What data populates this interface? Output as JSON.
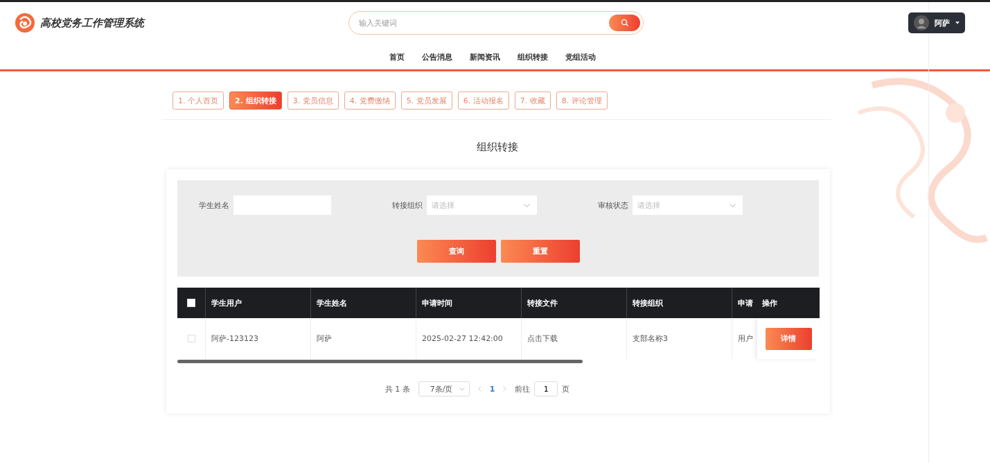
{
  "header": {
    "title": "高校党务工作管理系统",
    "search": {
      "placeholder": "输入关键词"
    },
    "user": {
      "name": "阿萨"
    }
  },
  "nav": [
    "首页",
    "公告消息",
    "新闻资讯",
    "组织转接",
    "党组活动"
  ],
  "tabs": [
    {
      "label": "1. 个人首页",
      "selected": false
    },
    {
      "label": "2. 组织转接",
      "selected": true
    },
    {
      "label": "3. 党员信息",
      "selected": false
    },
    {
      "label": "4. 党费缴纳",
      "selected": false
    },
    {
      "label": "5. 党员发展",
      "selected": false
    },
    {
      "label": "6. 活动报名",
      "selected": false
    },
    {
      "label": "7. 收藏",
      "selected": false
    },
    {
      "label": "8. 评论管理",
      "selected": false
    }
  ],
  "page_title": "组织转接",
  "filters": [
    {
      "kind": "input",
      "label": "学生姓名"
    },
    {
      "kind": "select",
      "label": "转接组织",
      "placeholder": "请选择"
    },
    {
      "kind": "select",
      "label": "审核状态",
      "placeholder": "请选择"
    }
  ],
  "filter_buttons": [
    "查询",
    "重置"
  ],
  "table": {
    "all_checked": false,
    "columns": [
      "学生用户",
      "学生姓名",
      "申请时间",
      "转接文件",
      "转接组织",
      "申请"
    ],
    "action_column": "操作",
    "rows": [
      {
        "checked": false,
        "cells": [
          "阿萨-123123",
          "阿萨",
          "2025-02-27 12:42:00",
          "点击下载",
          "支部名称3",
          "用户"
        ],
        "action": "详情"
      }
    ]
  },
  "pagination": {
    "total": "共 1 条",
    "page_size": "7条/页",
    "pages": [
      {
        "label": "1",
        "selected": true
      }
    ],
    "goto_label": "前往",
    "goto_value": "1",
    "goto_suffix": "页"
  }
}
